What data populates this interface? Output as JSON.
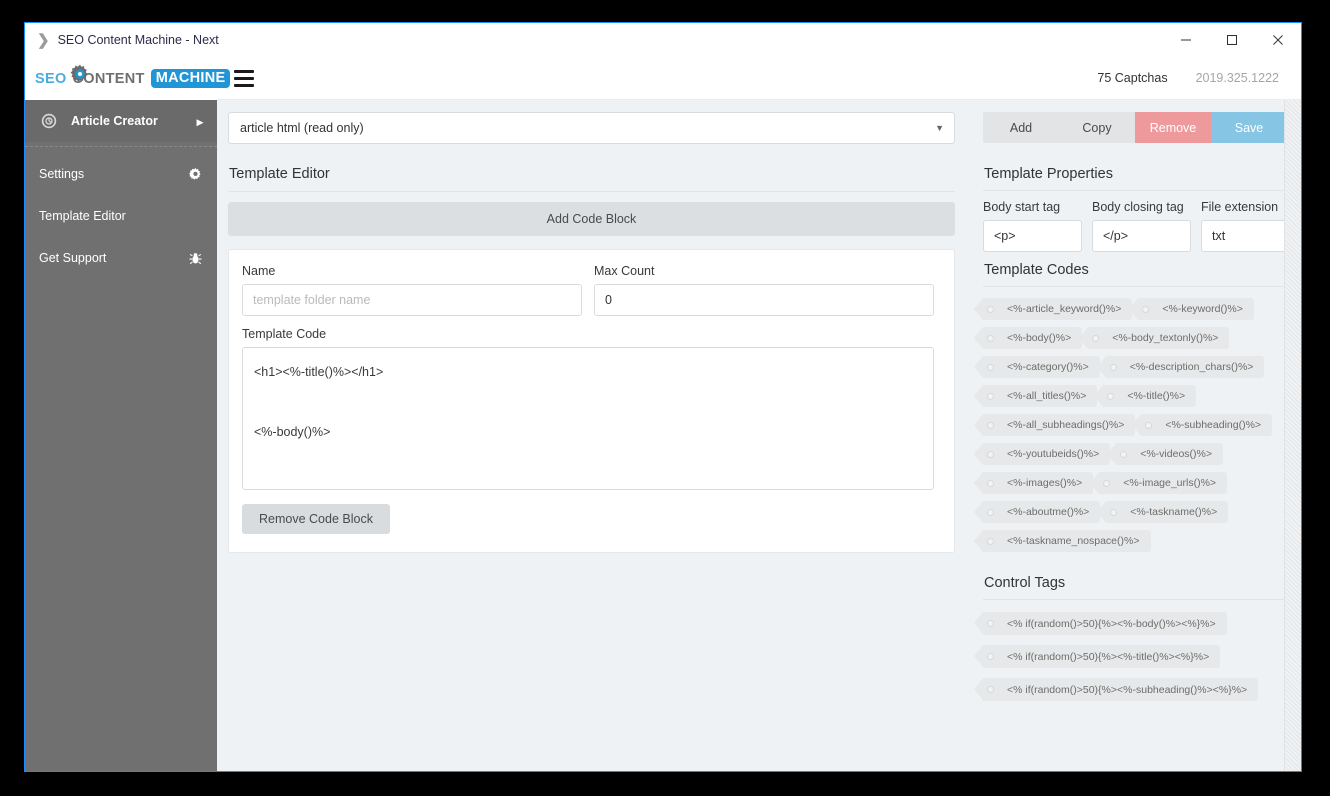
{
  "window": {
    "title": "SEO Content Machine - Next",
    "app_icon": "chevron-double-right-icon",
    "controls": {
      "minimize": "–",
      "maximize": "□",
      "close": "✕"
    }
  },
  "brand": {
    "seo": "SEO",
    "content": "CONTENT",
    "machine": "MACHINE",
    "gear_icon": "gear-icon"
  },
  "sidebar": {
    "items": [
      {
        "label": "Article Creator",
        "icon": "clock-gear-icon",
        "chevron": "▸",
        "active": true
      },
      {
        "label": "Settings",
        "icon": "gear-icon"
      },
      {
        "label": "Template Editor",
        "icon": ""
      },
      {
        "label": "Get Support",
        "icon": "bug-icon"
      }
    ]
  },
  "topbar": {
    "menu_icon": "hamburger-menu-icon",
    "captchas": "75 Captchas",
    "version": "2019.325.1222"
  },
  "main": {
    "template_select": {
      "value": "article html (read only)",
      "caret_icon": "chevron-down-icon"
    },
    "editor_heading": "Template Editor",
    "add_code_block_label": "Add Code Block",
    "code_block": {
      "name_label": "Name",
      "name_value": "",
      "name_placeholder": "template folder name",
      "max_count_label": "Max Count",
      "max_count_value": "0",
      "template_code_label": "Template Code",
      "template_code_value": "<h1><%-title()%></h1>\n\n<%-body()%>",
      "remove_label": "Remove Code Block"
    }
  },
  "right_panel": {
    "actions": [
      {
        "label": "Add",
        "style": "neutral"
      },
      {
        "label": "Copy",
        "style": "neutral"
      },
      {
        "label": "Remove",
        "style": "remove"
      },
      {
        "label": "Save",
        "style": "save"
      }
    ],
    "properties_heading": "Template Properties",
    "properties": [
      {
        "label": "Body start tag",
        "value": "<p>"
      },
      {
        "label": "Body closing tag",
        "value": "</p>"
      },
      {
        "label": "File extension",
        "value": "txt"
      }
    ],
    "template_codes_heading": "Template Codes",
    "template_codes": [
      "<%-article_keyword()%>",
      "<%-keyword()%>",
      "<%-body()%>",
      "<%-body_textonly()%>",
      "<%-category()%>",
      "<%-description_chars()%>",
      "<%-all_titles()%>",
      "<%-title()%>",
      "<%-all_subheadings()%>",
      "<%-subheading()%>",
      "<%-youtubeids()%>",
      "<%-videos()%>",
      "<%-images()%>",
      "<%-image_urls()%>",
      "<%-aboutme()%>",
      "<%-taskname()%>",
      "<%-taskname_nospace()%>"
    ],
    "control_tags_heading": "Control Tags",
    "control_tags": [
      "<% if(random()>50){%><%-body()%><%}%>",
      "<% if(random()>50){%><%-title()%><%}%>",
      "<% if(random()>50){%><%-subheading()%><%}%>"
    ]
  },
  "colors": {
    "accent_blue": "#1a8cff",
    "sidebar": "#707070",
    "remove": "#ee9a9c",
    "save": "#86c5e3",
    "canvas": "#eef2f4"
  }
}
